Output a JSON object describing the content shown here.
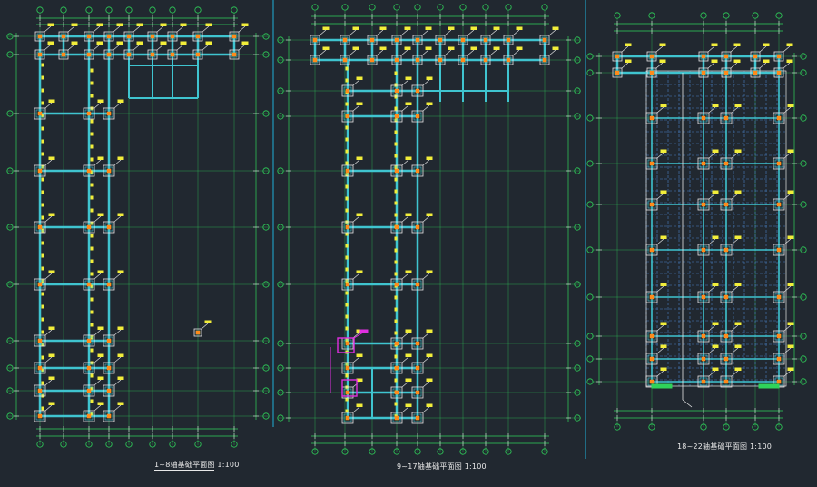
{
  "drawing_titles": [
    {
      "text": "1~8轴基础平面图  1:100"
    },
    {
      "text": "9~17轴基础平面图  1:100"
    },
    {
      "text": "18~22轴基础平面图  1:100"
    }
  ],
  "colors": {
    "background": "#212830",
    "axis_line": "#2fd35a",
    "beam": "#3fc4cf",
    "footing": "#e8e8e8",
    "column": "#ff8a1a",
    "annotation": "#f2ee3a",
    "highlight": "#e02fe0",
    "divider": "#1fb0d8",
    "grid_dashed": "#4a82c6"
  }
}
